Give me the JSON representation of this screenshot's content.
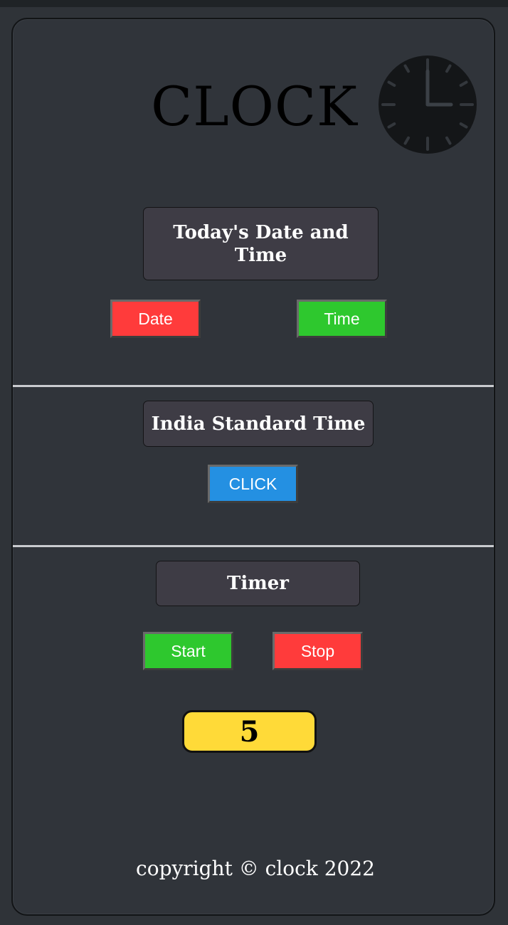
{
  "header": {
    "title": "CLOCK",
    "clock_icon": "analog-clock-icon"
  },
  "date_section": {
    "heading": "Today's Date and Time",
    "date_button": "Date",
    "time_button": "Time"
  },
  "ist_section": {
    "heading": "India Standard Time",
    "click_button": "CLICK"
  },
  "timer_section": {
    "heading": "Timer",
    "start_button": "Start",
    "stop_button": "Stop",
    "count": "5"
  },
  "footer": {
    "text": "copyright © clock 2022"
  },
  "colors": {
    "background": "#30343a",
    "red_button": "#ff3b3b",
    "green_button": "#2ec82e",
    "blue_button": "#2490e2",
    "counter": "#ffda38"
  }
}
